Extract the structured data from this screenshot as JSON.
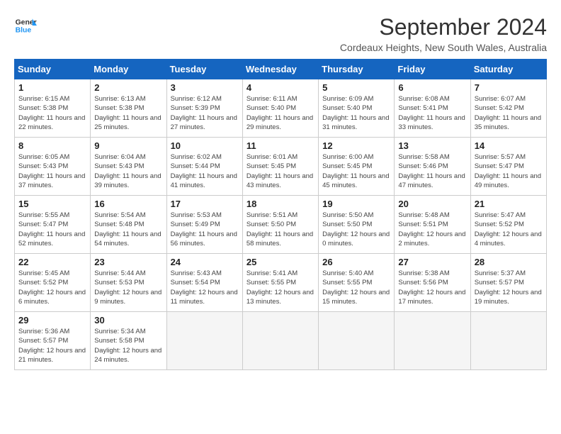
{
  "header": {
    "logo_line1": "General",
    "logo_line2": "Blue",
    "main_title": "September 2024",
    "subtitle": "Cordeaux Heights, New South Wales, Australia"
  },
  "calendar": {
    "days_of_week": [
      "Sunday",
      "Monday",
      "Tuesday",
      "Wednesday",
      "Thursday",
      "Friday",
      "Saturday"
    ],
    "weeks": [
      [
        {
          "day": "1",
          "sunrise": "6:15 AM",
          "sunset": "5:38 PM",
          "daylight": "11 hours and 22 minutes."
        },
        {
          "day": "2",
          "sunrise": "6:13 AM",
          "sunset": "5:38 PM",
          "daylight": "11 hours and 25 minutes."
        },
        {
          "day": "3",
          "sunrise": "6:12 AM",
          "sunset": "5:39 PM",
          "daylight": "11 hours and 27 minutes."
        },
        {
          "day": "4",
          "sunrise": "6:11 AM",
          "sunset": "5:40 PM",
          "daylight": "11 hours and 29 minutes."
        },
        {
          "day": "5",
          "sunrise": "6:09 AM",
          "sunset": "5:40 PM",
          "daylight": "11 hours and 31 minutes."
        },
        {
          "day": "6",
          "sunrise": "6:08 AM",
          "sunset": "5:41 PM",
          "daylight": "11 hours and 33 minutes."
        },
        {
          "day": "7",
          "sunrise": "6:07 AM",
          "sunset": "5:42 PM",
          "daylight": "11 hours and 35 minutes."
        }
      ],
      [
        {
          "day": "8",
          "sunrise": "6:05 AM",
          "sunset": "5:43 PM",
          "daylight": "11 hours and 37 minutes."
        },
        {
          "day": "9",
          "sunrise": "6:04 AM",
          "sunset": "5:43 PM",
          "daylight": "11 hours and 39 minutes."
        },
        {
          "day": "10",
          "sunrise": "6:02 AM",
          "sunset": "5:44 PM",
          "daylight": "11 hours and 41 minutes."
        },
        {
          "day": "11",
          "sunrise": "6:01 AM",
          "sunset": "5:45 PM",
          "daylight": "11 hours and 43 minutes."
        },
        {
          "day": "12",
          "sunrise": "6:00 AM",
          "sunset": "5:45 PM",
          "daylight": "11 hours and 45 minutes."
        },
        {
          "day": "13",
          "sunrise": "5:58 AM",
          "sunset": "5:46 PM",
          "daylight": "11 hours and 47 minutes."
        },
        {
          "day": "14",
          "sunrise": "5:57 AM",
          "sunset": "5:47 PM",
          "daylight": "11 hours and 49 minutes."
        }
      ],
      [
        {
          "day": "15",
          "sunrise": "5:55 AM",
          "sunset": "5:47 PM",
          "daylight": "11 hours and 52 minutes."
        },
        {
          "day": "16",
          "sunrise": "5:54 AM",
          "sunset": "5:48 PM",
          "daylight": "11 hours and 54 minutes."
        },
        {
          "day": "17",
          "sunrise": "5:53 AM",
          "sunset": "5:49 PM",
          "daylight": "11 hours and 56 minutes."
        },
        {
          "day": "18",
          "sunrise": "5:51 AM",
          "sunset": "5:50 PM",
          "daylight": "11 hours and 58 minutes."
        },
        {
          "day": "19",
          "sunrise": "5:50 AM",
          "sunset": "5:50 PM",
          "daylight": "12 hours and 0 minutes."
        },
        {
          "day": "20",
          "sunrise": "5:48 AM",
          "sunset": "5:51 PM",
          "daylight": "12 hours and 2 minutes."
        },
        {
          "day": "21",
          "sunrise": "5:47 AM",
          "sunset": "5:52 PM",
          "daylight": "12 hours and 4 minutes."
        }
      ],
      [
        {
          "day": "22",
          "sunrise": "5:45 AM",
          "sunset": "5:52 PM",
          "daylight": "12 hours and 6 minutes."
        },
        {
          "day": "23",
          "sunrise": "5:44 AM",
          "sunset": "5:53 PM",
          "daylight": "12 hours and 9 minutes."
        },
        {
          "day": "24",
          "sunrise": "5:43 AM",
          "sunset": "5:54 PM",
          "daylight": "12 hours and 11 minutes."
        },
        {
          "day": "25",
          "sunrise": "5:41 AM",
          "sunset": "5:55 PM",
          "daylight": "12 hours and 13 minutes."
        },
        {
          "day": "26",
          "sunrise": "5:40 AM",
          "sunset": "5:55 PM",
          "daylight": "12 hours and 15 minutes."
        },
        {
          "day": "27",
          "sunrise": "5:38 AM",
          "sunset": "5:56 PM",
          "daylight": "12 hours and 17 minutes."
        },
        {
          "day": "28",
          "sunrise": "5:37 AM",
          "sunset": "5:57 PM",
          "daylight": "12 hours and 19 minutes."
        }
      ],
      [
        {
          "day": "29",
          "sunrise": "5:36 AM",
          "sunset": "5:57 PM",
          "daylight": "12 hours and 21 minutes."
        },
        {
          "day": "30",
          "sunrise": "5:34 AM",
          "sunset": "5:58 PM",
          "daylight": "12 hours and 24 minutes."
        },
        null,
        null,
        null,
        null,
        null
      ]
    ]
  }
}
